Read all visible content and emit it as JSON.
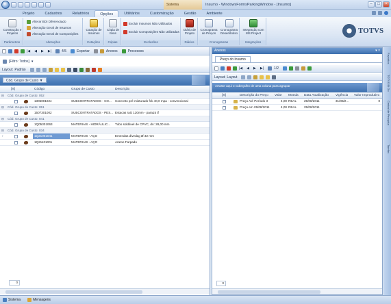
{
  "window": {
    "title": "Insumo - WindowsFormsParkingWindow - [Insumo]",
    "context_tab": "Sistema"
  },
  "ribbon": {
    "tabs": [
      "Projeto",
      "Cadastros",
      "Relatórios",
      "Opções",
      "Utilitários",
      "Customização",
      "Gestão",
      "Ambiente"
    ],
    "active_tab": "Opções",
    "groups": {
      "parametros": {
        "label": "Parâmetros",
        "btn": "Construção e Projetos"
      },
      "alteracoes": {
        "label": "Alterações",
        "items": [
          "Alterar BDI Diferenciado",
          "Alteração Geral de Insumos",
          "Alteração Geral de Composições"
        ]
      },
      "cotacoes": {
        "label": "Cotações",
        "btn": "Cotação de Insumos"
      },
      "copias": {
        "label": "Cópias",
        "btn": "Cópia de Itens"
      },
      "exclusoes": {
        "label": "Exclusões",
        "items": [
          "Excluir Insumos Não Utilizados",
          "Excluir Composições Não Utilizadas"
        ]
      },
      "diarios": {
        "label": "Diários",
        "btn": "Diário de Projeto"
      },
      "cronogramas": {
        "label": "Cronogramas",
        "btns": [
          "Cronograma de Preços",
          "Cronograma Desembolso"
        ]
      },
      "integracoes": {
        "label": "Integrações",
        "btn": "Integração com MS Project"
      }
    },
    "brand": "TOTVS"
  },
  "left": {
    "toolbar": {
      "page": "4/5",
      "exportar": "Exportar",
      "anexos": "Anexos",
      "processos": "Processos"
    },
    "filter": "[Filtro: Todos]",
    "layout_label": "Layout:",
    "layout_value": "Padrão",
    "group_chip": "Cód. Grupo de Custo",
    "columns": [
      "[X]",
      "Código",
      "Grupo de Custo",
      "Descrição"
    ],
    "groups": [
      {
        "label": "Cód. Grupo de Custo: 052",
        "rows": [
          [
            "1305001024",
            "SUBCONTRATADOS - CO...",
            "Concreto pré-misturado fck 40,0 mpa - convencional"
          ]
        ]
      },
      {
        "label": "Cód. Grupo de Custo: 051",
        "rows": [
          [
            "1507301002",
            "SUBCONTRATADOS - PES...",
            "Estacas raiz 120mm - para15 tf"
          ]
        ]
      },
      {
        "label": "Cód. Grupo de Custo: 041",
        "rows": [
          [
            "1Q05301063",
            "MATERIAIS - HIDRÁULIC...",
            "Tubo soldável de CPVC, dn: 28,00 mm"
          ]
        ]
      },
      {
        "label": "Cód. Grupo de Custo: 034",
        "rows": [
          [
            "1Q21001041",
            "MATERIAIS - AÇO",
            "Emendas divedag Ø 32 mm"
          ],
          [
            "1Q21101001",
            "MATERIAIS - AÇO",
            "Arame Farpado"
          ]
        ]
      }
    ],
    "footer_count": "0"
  },
  "right": {
    "header": "Anexos",
    "tab": "Preço do Insumo",
    "page": "1/2",
    "layout_label": "Layout:",
    "layout_value": "Layout",
    "group_hint": "Arraste aqui o cabeçalho de uma coluna para agrupar",
    "columns": [
      "[X]",
      "Descrição do Preço",
      "Valor",
      "Moeda",
      "Data Atualização",
      "Vigência",
      "Valor Improdutivo"
    ],
    "rows": [
      [
        "Preço Até Período 3",
        "4,00",
        "REAL",
        "25/08/2011",
        "31/08/2...",
        "0"
      ],
      [
        "Preço em 25/08/2011",
        "4,00",
        "REAL",
        "25/08/2011",
        "",
        ""
      ]
    ],
    "footer_count": "0"
  },
  "sidebar": [
    "Favoritos",
    "TOTVS BI Go",
    "Central de Pesquisa",
    "Tarefas"
  ],
  "status": {
    "sistema": "Sistema",
    "mensagens": "Mensagens"
  }
}
